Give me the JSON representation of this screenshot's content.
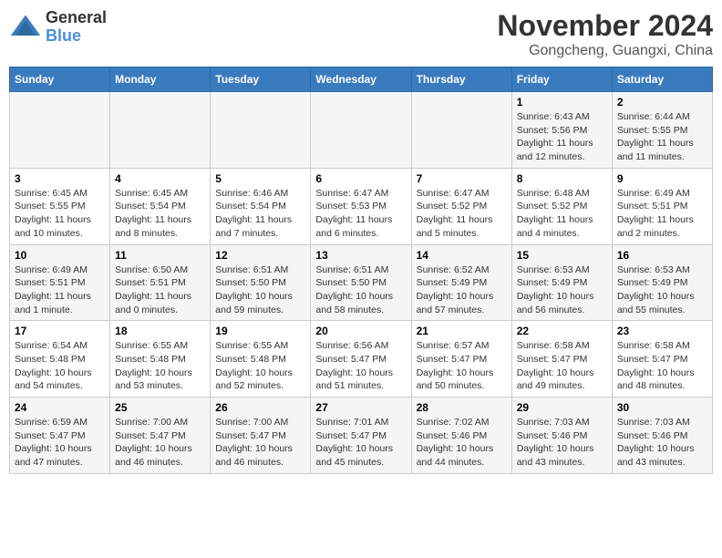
{
  "logo": {
    "general": "General",
    "blue": "Blue"
  },
  "title": "November 2024",
  "subtitle": "Gongcheng, Guangxi, China",
  "weekdays": [
    "Sunday",
    "Monday",
    "Tuesday",
    "Wednesday",
    "Thursday",
    "Friday",
    "Saturday"
  ],
  "weeks": [
    [
      {
        "day": "",
        "info": ""
      },
      {
        "day": "",
        "info": ""
      },
      {
        "day": "",
        "info": ""
      },
      {
        "day": "",
        "info": ""
      },
      {
        "day": "",
        "info": ""
      },
      {
        "day": "1",
        "info": "Sunrise: 6:43 AM\nSunset: 5:56 PM\nDaylight: 11 hours and 12 minutes."
      },
      {
        "day": "2",
        "info": "Sunrise: 6:44 AM\nSunset: 5:55 PM\nDaylight: 11 hours and 11 minutes."
      }
    ],
    [
      {
        "day": "3",
        "info": "Sunrise: 6:45 AM\nSunset: 5:55 PM\nDaylight: 11 hours and 10 minutes."
      },
      {
        "day": "4",
        "info": "Sunrise: 6:45 AM\nSunset: 5:54 PM\nDaylight: 11 hours and 8 minutes."
      },
      {
        "day": "5",
        "info": "Sunrise: 6:46 AM\nSunset: 5:54 PM\nDaylight: 11 hours and 7 minutes."
      },
      {
        "day": "6",
        "info": "Sunrise: 6:47 AM\nSunset: 5:53 PM\nDaylight: 11 hours and 6 minutes."
      },
      {
        "day": "7",
        "info": "Sunrise: 6:47 AM\nSunset: 5:52 PM\nDaylight: 11 hours and 5 minutes."
      },
      {
        "day": "8",
        "info": "Sunrise: 6:48 AM\nSunset: 5:52 PM\nDaylight: 11 hours and 4 minutes."
      },
      {
        "day": "9",
        "info": "Sunrise: 6:49 AM\nSunset: 5:51 PM\nDaylight: 11 hours and 2 minutes."
      }
    ],
    [
      {
        "day": "10",
        "info": "Sunrise: 6:49 AM\nSunset: 5:51 PM\nDaylight: 11 hours and 1 minute."
      },
      {
        "day": "11",
        "info": "Sunrise: 6:50 AM\nSunset: 5:51 PM\nDaylight: 11 hours and 0 minutes."
      },
      {
        "day": "12",
        "info": "Sunrise: 6:51 AM\nSunset: 5:50 PM\nDaylight: 10 hours and 59 minutes."
      },
      {
        "day": "13",
        "info": "Sunrise: 6:51 AM\nSunset: 5:50 PM\nDaylight: 10 hours and 58 minutes."
      },
      {
        "day": "14",
        "info": "Sunrise: 6:52 AM\nSunset: 5:49 PM\nDaylight: 10 hours and 57 minutes."
      },
      {
        "day": "15",
        "info": "Sunrise: 6:53 AM\nSunset: 5:49 PM\nDaylight: 10 hours and 56 minutes."
      },
      {
        "day": "16",
        "info": "Sunrise: 6:53 AM\nSunset: 5:49 PM\nDaylight: 10 hours and 55 minutes."
      }
    ],
    [
      {
        "day": "17",
        "info": "Sunrise: 6:54 AM\nSunset: 5:48 PM\nDaylight: 10 hours and 54 minutes."
      },
      {
        "day": "18",
        "info": "Sunrise: 6:55 AM\nSunset: 5:48 PM\nDaylight: 10 hours and 53 minutes."
      },
      {
        "day": "19",
        "info": "Sunrise: 6:55 AM\nSunset: 5:48 PM\nDaylight: 10 hours and 52 minutes."
      },
      {
        "day": "20",
        "info": "Sunrise: 6:56 AM\nSunset: 5:47 PM\nDaylight: 10 hours and 51 minutes."
      },
      {
        "day": "21",
        "info": "Sunrise: 6:57 AM\nSunset: 5:47 PM\nDaylight: 10 hours and 50 minutes."
      },
      {
        "day": "22",
        "info": "Sunrise: 6:58 AM\nSunset: 5:47 PM\nDaylight: 10 hours and 49 minutes."
      },
      {
        "day": "23",
        "info": "Sunrise: 6:58 AM\nSunset: 5:47 PM\nDaylight: 10 hours and 48 minutes."
      }
    ],
    [
      {
        "day": "24",
        "info": "Sunrise: 6:59 AM\nSunset: 5:47 PM\nDaylight: 10 hours and 47 minutes."
      },
      {
        "day": "25",
        "info": "Sunrise: 7:00 AM\nSunset: 5:47 PM\nDaylight: 10 hours and 46 minutes."
      },
      {
        "day": "26",
        "info": "Sunrise: 7:00 AM\nSunset: 5:47 PM\nDaylight: 10 hours and 46 minutes."
      },
      {
        "day": "27",
        "info": "Sunrise: 7:01 AM\nSunset: 5:47 PM\nDaylight: 10 hours and 45 minutes."
      },
      {
        "day": "28",
        "info": "Sunrise: 7:02 AM\nSunset: 5:46 PM\nDaylight: 10 hours and 44 minutes."
      },
      {
        "day": "29",
        "info": "Sunrise: 7:03 AM\nSunset: 5:46 PM\nDaylight: 10 hours and 43 minutes."
      },
      {
        "day": "30",
        "info": "Sunrise: 7:03 AM\nSunset: 5:46 PM\nDaylight: 10 hours and 43 minutes."
      }
    ]
  ]
}
